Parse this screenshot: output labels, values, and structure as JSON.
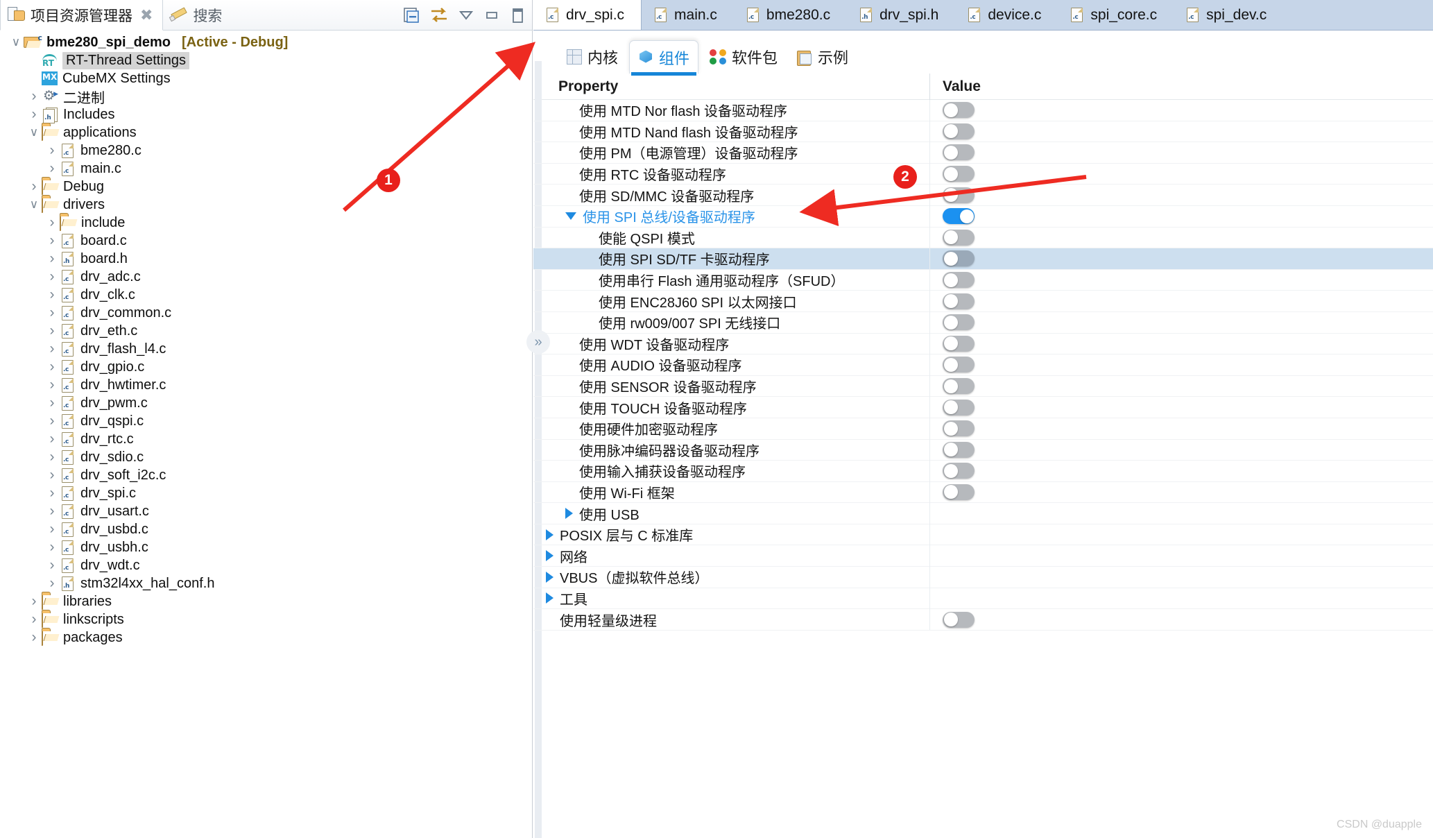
{
  "left_panel": {
    "tabs": [
      {
        "label": "项目资源管理器",
        "icon": "project-explorer-icon",
        "active": true,
        "closable": true
      },
      {
        "label": "搜索",
        "icon": "search-pencil-icon",
        "active": false,
        "closable": false
      }
    ],
    "toolbar_icons": [
      "collapse-all-icon",
      "link-with-editor-icon",
      "view-menu-icon",
      "minimize-icon",
      "maximize-icon"
    ],
    "tree": [
      {
        "level": 0,
        "twist": "open",
        "icon": "project-folder-c-icon",
        "label": "bme280_spi_demo",
        "bold": true,
        "tag": "[Active - Debug]"
      },
      {
        "level": 1,
        "twist": "none",
        "icon": "rt-thread-icon",
        "label": "RT-Thread Settings",
        "selected": true
      },
      {
        "level": 1,
        "twist": "none",
        "icon": "cubemx-icon",
        "label": "CubeMX Settings"
      },
      {
        "level": 1,
        "twist": "closed",
        "icon": "binaries-icon",
        "label": "二进制"
      },
      {
        "level": 1,
        "twist": "closed",
        "icon": "includes-icon",
        "label": "Includes"
      },
      {
        "level": 1,
        "twist": "open",
        "icon": "folder-icon",
        "label": "applications"
      },
      {
        "level": 2,
        "twist": "closed",
        "icon": "c-file-icon",
        "label": "bme280.c"
      },
      {
        "level": 2,
        "twist": "closed",
        "icon": "c-file-icon",
        "label": "main.c"
      },
      {
        "level": 1,
        "twist": "closed",
        "icon": "folder-icon",
        "label": "Debug"
      },
      {
        "level": 1,
        "twist": "open",
        "icon": "folder-icon",
        "label": "drivers"
      },
      {
        "level": 2,
        "twist": "closed",
        "icon": "folder-icon",
        "label": "include"
      },
      {
        "level": 2,
        "twist": "closed",
        "icon": "c-file-icon",
        "label": "board.c"
      },
      {
        "level": 2,
        "twist": "closed",
        "icon": "h-file-icon",
        "label": "board.h"
      },
      {
        "level": 2,
        "twist": "closed",
        "icon": "c-file-icon",
        "label": "drv_adc.c"
      },
      {
        "level": 2,
        "twist": "closed",
        "icon": "c-file-icon",
        "label": "drv_clk.c"
      },
      {
        "level": 2,
        "twist": "closed",
        "icon": "c-file-icon",
        "label": "drv_common.c"
      },
      {
        "level": 2,
        "twist": "closed",
        "icon": "c-file-icon",
        "label": "drv_eth.c"
      },
      {
        "level": 2,
        "twist": "closed",
        "icon": "c-file-icon",
        "label": "drv_flash_l4.c"
      },
      {
        "level": 2,
        "twist": "closed",
        "icon": "c-file-icon",
        "label": "drv_gpio.c"
      },
      {
        "level": 2,
        "twist": "closed",
        "icon": "c-file-icon",
        "label": "drv_hwtimer.c"
      },
      {
        "level": 2,
        "twist": "closed",
        "icon": "c-file-icon",
        "label": "drv_pwm.c"
      },
      {
        "level": 2,
        "twist": "closed",
        "icon": "c-file-icon",
        "label": "drv_qspi.c"
      },
      {
        "level": 2,
        "twist": "closed",
        "icon": "c-file-icon",
        "label": "drv_rtc.c"
      },
      {
        "level": 2,
        "twist": "closed",
        "icon": "c-file-icon",
        "label": "drv_sdio.c"
      },
      {
        "level": 2,
        "twist": "closed",
        "icon": "c-file-icon",
        "label": "drv_soft_i2c.c"
      },
      {
        "level": 2,
        "twist": "closed",
        "icon": "c-file-icon",
        "label": "drv_spi.c"
      },
      {
        "level": 2,
        "twist": "closed",
        "icon": "c-file-icon",
        "label": "drv_usart.c"
      },
      {
        "level": 2,
        "twist": "closed",
        "icon": "c-file-icon",
        "label": "drv_usbd.c"
      },
      {
        "level": 2,
        "twist": "closed",
        "icon": "c-file-icon",
        "label": "drv_usbh.c"
      },
      {
        "level": 2,
        "twist": "closed",
        "icon": "c-file-icon",
        "label": "drv_wdt.c"
      },
      {
        "level": 2,
        "twist": "closed",
        "icon": "h-file-icon",
        "label": "stm32l4xx_hal_conf.h"
      },
      {
        "level": 1,
        "twist": "closed",
        "icon": "folder-icon",
        "label": "libraries"
      },
      {
        "level": 1,
        "twist": "closed",
        "icon": "folder-icon",
        "label": "linkscripts"
      },
      {
        "level": 1,
        "twist": "closed",
        "icon": "folder-icon",
        "label": "packages"
      }
    ]
  },
  "editor_tabs": [
    {
      "label": "drv_spi.c",
      "icon": "c-file-icon",
      "active": true
    },
    {
      "label": "main.c",
      "icon": "c-file-icon",
      "active": false
    },
    {
      "label": "bme280.c",
      "icon": "c-file-icon",
      "active": false
    },
    {
      "label": "drv_spi.h",
      "icon": "h-file-icon",
      "active": false
    },
    {
      "label": "device.c",
      "icon": "c-file-icon",
      "active": false
    },
    {
      "label": "spi_core.c",
      "icon": "c-file-icon",
      "active": false
    },
    {
      "label": "spi_dev.c",
      "icon": "c-file-icon",
      "active": false
    }
  ],
  "config_tabs": [
    {
      "label": "内核",
      "icon": "kernel-grid-icon",
      "active": false
    },
    {
      "label": "组件",
      "icon": "component-cube-icon",
      "active": true
    },
    {
      "label": "软件包",
      "icon": "package-dots-icon",
      "active": false
    },
    {
      "label": "示例",
      "icon": "example-clipboard-icon",
      "active": false
    }
  ],
  "table": {
    "headers": {
      "property": "Property",
      "value": "Value"
    },
    "rows": [
      {
        "label": "使用 MTD Nor flash 设备驱动程序",
        "indent": 1,
        "twist": "none",
        "value": "off"
      },
      {
        "label": "使用 MTD Nand flash 设备驱动程序",
        "indent": 1,
        "twist": "none",
        "value": "off"
      },
      {
        "label": "使用 PM（电源管理）设备驱动程序",
        "indent": 1,
        "twist": "none",
        "value": "off"
      },
      {
        "label": "使用 RTC 设备驱动程序",
        "indent": 1,
        "twist": "none",
        "value": "off"
      },
      {
        "label": "使用 SD/MMC 设备驱动程序",
        "indent": 1,
        "twist": "none",
        "value": "off"
      },
      {
        "label": "使用 SPI 总线/设备驱动程序",
        "indent": 1,
        "twist": "down",
        "value": "on",
        "link": true
      },
      {
        "label": "使能 QSPI 模式",
        "indent": 2,
        "twist": "none",
        "value": "off"
      },
      {
        "label": "使用 SPI SD/TF 卡驱动程序",
        "indent": 2,
        "twist": "none",
        "value": "off",
        "selected": true
      },
      {
        "label": "使用串行 Flash 通用驱动程序（SFUD）",
        "indent": 2,
        "twist": "none",
        "value": "off"
      },
      {
        "label": "使用 ENC28J60 SPI 以太网接口",
        "indent": 2,
        "twist": "none",
        "value": "off"
      },
      {
        "label": "使用 rw009/007 SPI 无线接口",
        "indent": 2,
        "twist": "none",
        "value": "off"
      },
      {
        "label": "使用 WDT 设备驱动程序",
        "indent": 1,
        "twist": "none",
        "value": "off"
      },
      {
        "label": "使用 AUDIO 设备驱动程序",
        "indent": 1,
        "twist": "none",
        "value": "off"
      },
      {
        "label": "使用 SENSOR 设备驱动程序",
        "indent": 1,
        "twist": "none",
        "value": "off"
      },
      {
        "label": "使用 TOUCH 设备驱动程序",
        "indent": 1,
        "twist": "none",
        "value": "off"
      },
      {
        "label": "使用硬件加密驱动程序",
        "indent": 1,
        "twist": "none",
        "value": "off"
      },
      {
        "label": "使用脉冲编码器设备驱动程序",
        "indent": 1,
        "twist": "none",
        "value": "off"
      },
      {
        "label": "使用输入捕获设备驱动程序",
        "indent": 1,
        "twist": "none",
        "value": "off"
      },
      {
        "label": "使用 Wi-Fi 框架",
        "indent": 1,
        "twist": "none",
        "value": "off"
      },
      {
        "label": "使用 USB",
        "indent": 1,
        "twist": "right",
        "value": "none"
      },
      {
        "label": "POSIX 层与 C 标准库",
        "indent": 0,
        "twist": "right",
        "value": "none"
      },
      {
        "label": "网络",
        "indent": 0,
        "twist": "right",
        "value": "none"
      },
      {
        "label": "VBUS（虚拟软件总线）",
        "indent": 0,
        "twist": "right",
        "value": "none"
      },
      {
        "label": "工具",
        "indent": 0,
        "twist": "right",
        "value": "none"
      },
      {
        "label": "使用轻量级进程",
        "indent": 0,
        "twist": "none",
        "value": "off"
      }
    ]
  },
  "annotations": [
    {
      "id": "1",
      "label": "1"
    },
    {
      "id": "2",
      "label": "2"
    }
  ],
  "watermark": "CSDN @duapple",
  "colors": {
    "accent_blue": "#1686d8",
    "toggle_on": "#1b91f0",
    "toggle_off": "#b6b9bd",
    "selection": "#cddfef",
    "annotation_red": "#e8201b",
    "editor_tabbar": "#c6d5e8"
  }
}
